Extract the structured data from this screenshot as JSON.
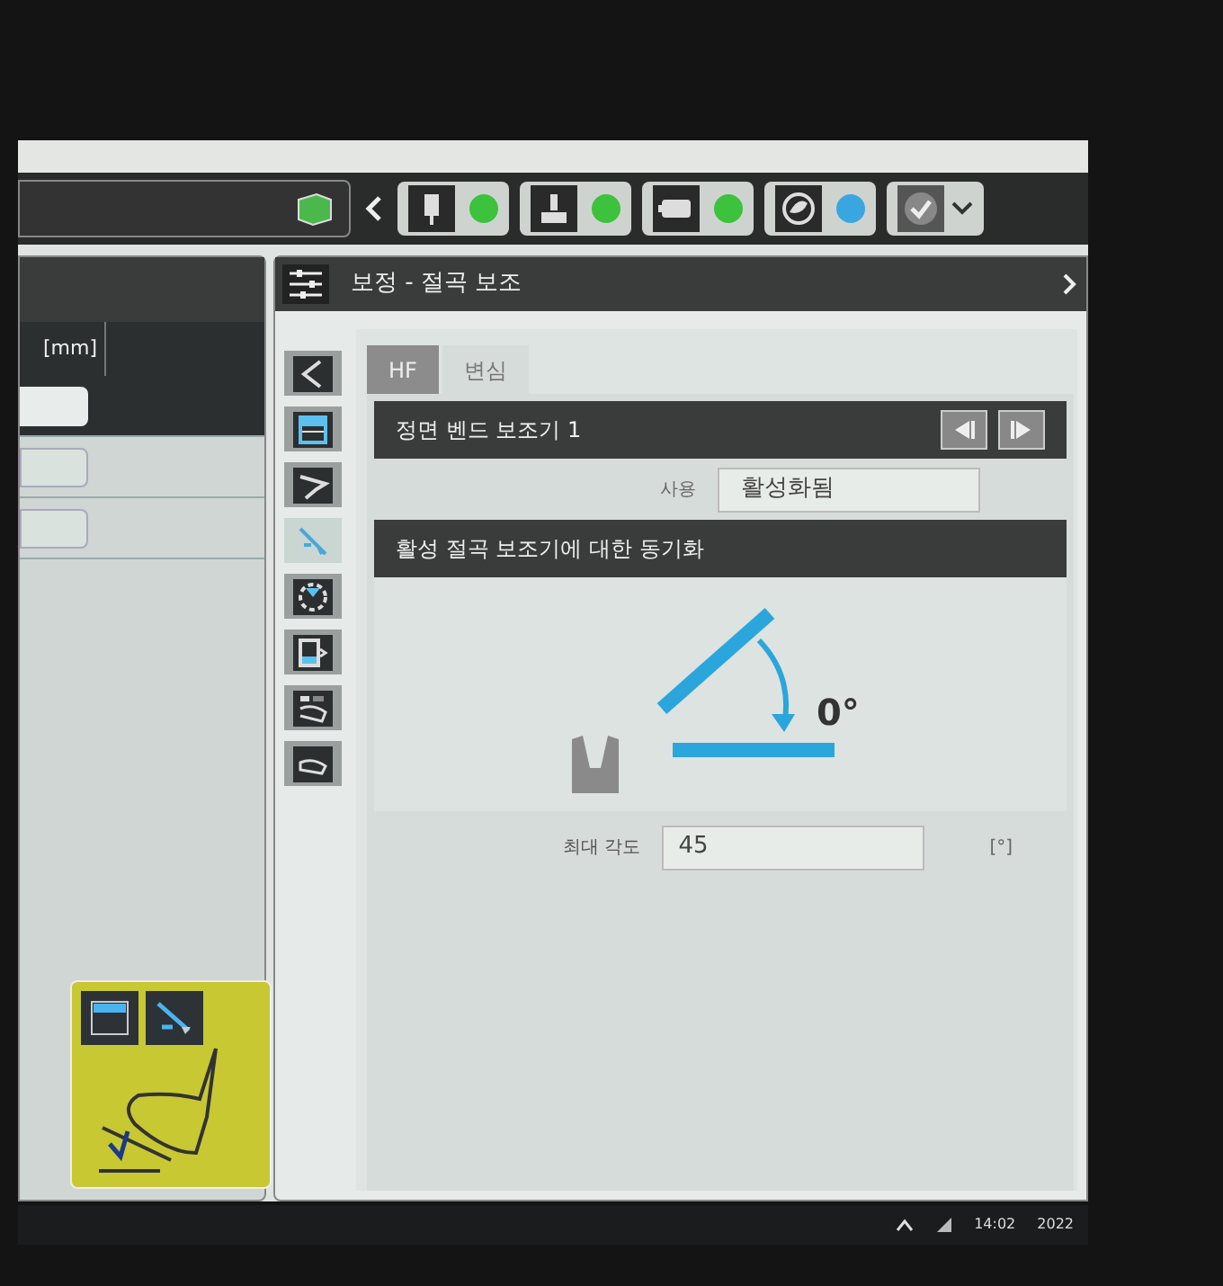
{
  "toolbar": {
    "status_items": [
      {
        "color": "#3cc23c"
      },
      {
        "color": "#3cc23c"
      },
      {
        "color": "#3cc23c"
      },
      {
        "color": "#3aa6e0"
      }
    ]
  },
  "left_panel": {
    "column_header": "[mm]",
    "fields": [
      {
        "selected": true
      },
      {
        "selected": false
      },
      {
        "selected": false
      }
    ]
  },
  "right_panel": {
    "title": "보정 - 절곡 보조",
    "side_tools": [
      {
        "selected": false
      },
      {
        "selected": false
      },
      {
        "selected": false
      },
      {
        "selected": true
      },
      {
        "selected": false
      },
      {
        "selected": false
      },
      {
        "selected": false
      },
      {
        "selected": false
      }
    ],
    "tabs": [
      {
        "label": "HF",
        "selected": false
      },
      {
        "label": "변심",
        "selected": true
      }
    ],
    "section_title": "정면 벤드 보조기 1",
    "use_field": {
      "label": "사용",
      "value": "활성화됨"
    },
    "sync_title": "활성 절곡 보조기에 대한 동기화",
    "angle_label": "0°",
    "max_angle": {
      "label": "최대 각도",
      "value": "45",
      "unit": "[°]"
    }
  },
  "taskbar": {
    "time": "14:02",
    "date": "2022"
  }
}
